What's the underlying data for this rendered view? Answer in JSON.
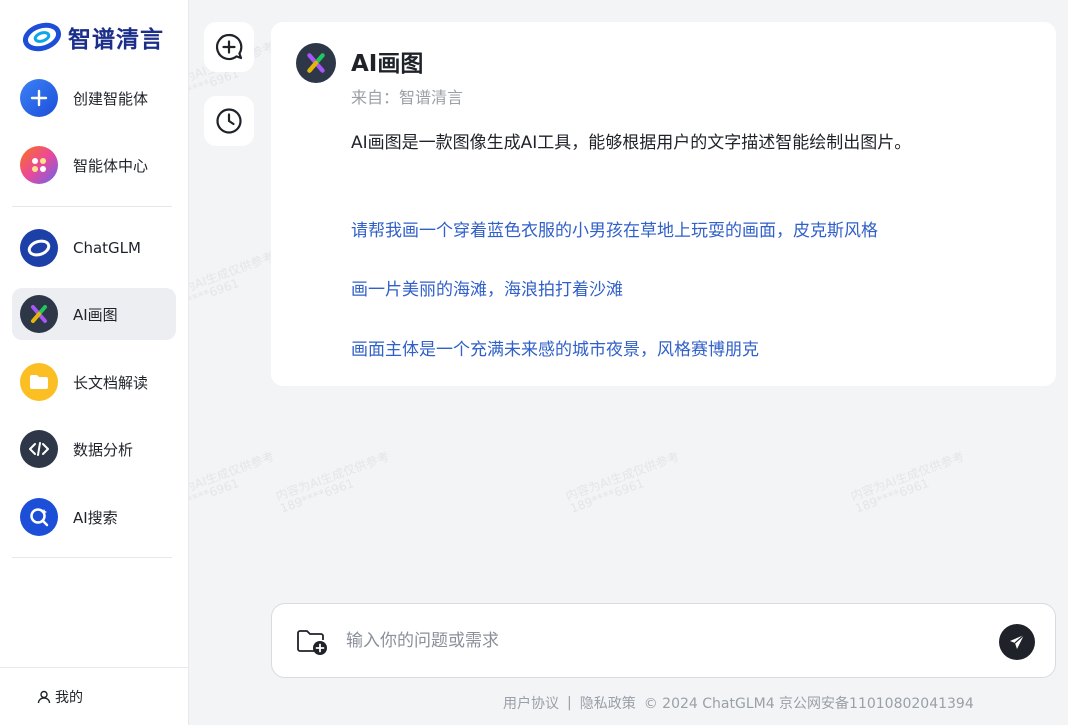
{
  "brand": {
    "name": "智谱清言"
  },
  "sidebar": {
    "items": [
      {
        "label": "创建智能体",
        "icon": "plus-icon"
      },
      {
        "label": "智能体中心",
        "icon": "apps-grid-icon"
      },
      {
        "label": "ChatGLM",
        "icon": "chatglm-logo-icon"
      },
      {
        "label": "AI画图",
        "icon": "ai-drawing-icon",
        "active": true
      },
      {
        "label": "长文档解读",
        "icon": "folder-icon"
      },
      {
        "label": "数据分析",
        "icon": "code-icon"
      },
      {
        "label": "AI搜索",
        "icon": "search-spark-icon"
      }
    ],
    "user_label": "我的"
  },
  "tools": [
    {
      "name": "new-chat",
      "icon": "chat-plus-icon"
    },
    {
      "name": "history",
      "icon": "clock-icon"
    }
  ],
  "agent": {
    "name": "AI画图",
    "from": "来自：智谱清言",
    "description": "AI画图是一款图像生成AI工具，能够根据用户的文字描述智能绘制出图片。",
    "suggestions": [
      "请帮我画一个穿着蓝色衣服的小男孩在草地上玩耍的画面，皮克斯风格",
      "画一片美丽的海滩，海浪拍打着沙滩",
      "画面主体是一个充满未来感的城市夜景，风格赛博朋克"
    ]
  },
  "input": {
    "placeholder": "输入你的问题或需求",
    "value": ""
  },
  "footer": {
    "terms": "用户协议",
    "separator": "|",
    "privacy": "隐私政策",
    "copyright": "© 2024 ChatGLM4 京公网安备11010802041394"
  },
  "watermark": {
    "line1": "内容为AI生成仅供参考",
    "line2": "189****6961"
  },
  "colors": {
    "accent_link": "#3060c8",
    "brand_blue": "#1b2f8a",
    "active_bg": "#eceef2"
  }
}
